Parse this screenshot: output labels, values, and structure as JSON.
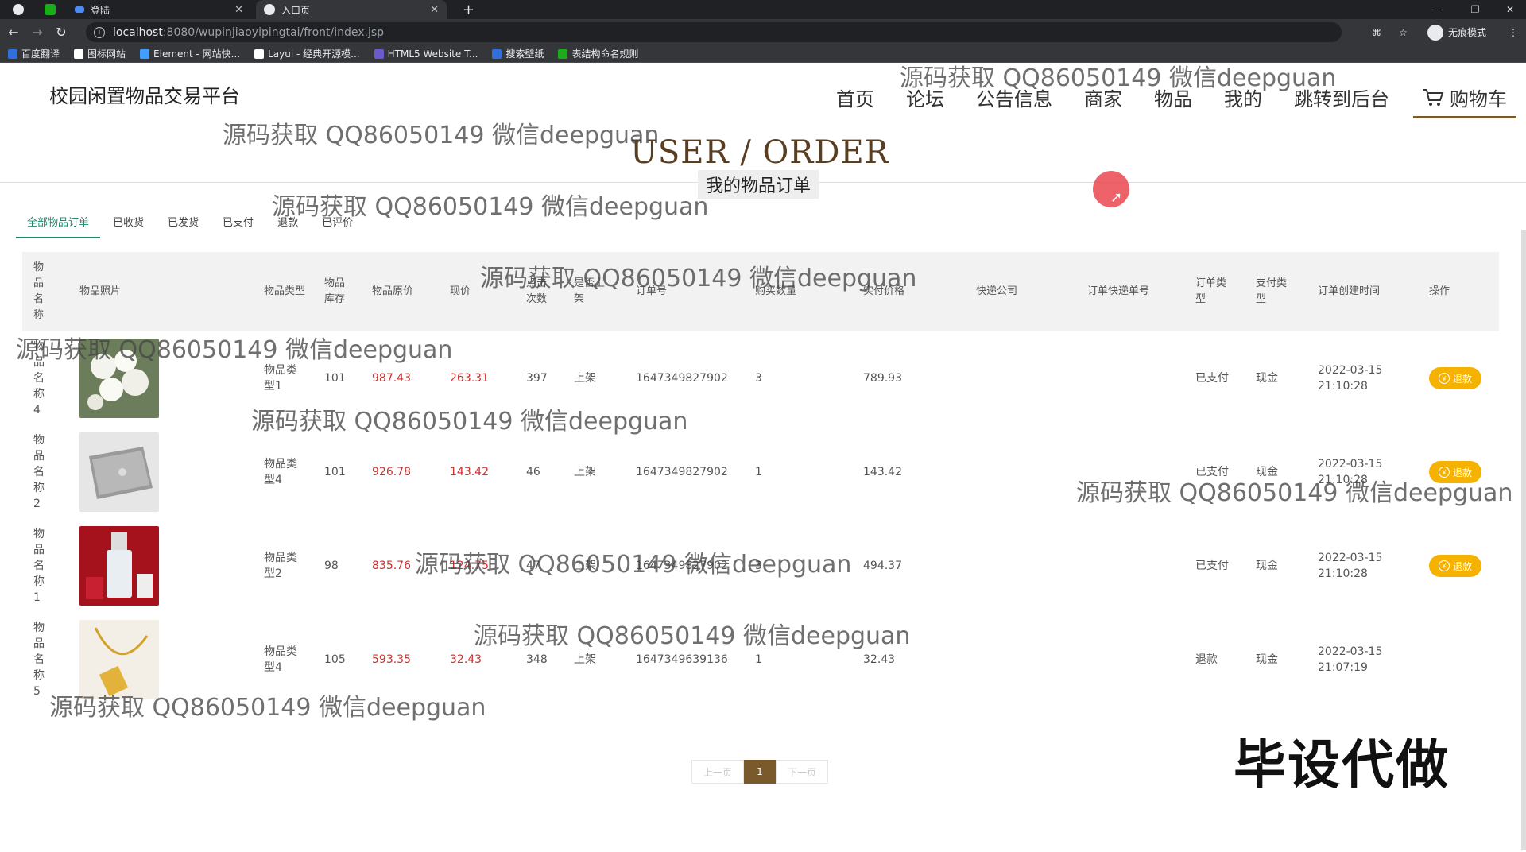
{
  "browser": {
    "tabs": [
      {
        "title": "",
        "favicon_color": "#1aad19"
      },
      {
        "title": "登陆",
        "favicon_color": "#4b8bf5"
      },
      {
        "title": "入口页",
        "favicon_color": "#e8eaed"
      }
    ],
    "new_tab": "+",
    "window_controls": [
      "—",
      "❐",
      "✕"
    ],
    "url_host": "localhost",
    "url_path": ":8080/wupinjiaoyipingtai/front/index.jsp",
    "incognito_label": "无痕模式",
    "bookmarks": [
      {
        "label": "百度翻译",
        "color": "#2f6fe0"
      },
      {
        "label": "图标网站",
        "color": "#ffffff"
      },
      {
        "label": "Element - 网站快...",
        "color": "#409eff"
      },
      {
        "label": "Layui - 经典开源模...",
        "color": "#ffffff"
      },
      {
        "label": "HTML5 Website T...",
        "color": "#6a5acd"
      },
      {
        "label": "搜索壁纸",
        "color": "#2f6fe0"
      },
      {
        "label": "表结构命名规则",
        "color": "#1aad19"
      }
    ]
  },
  "site": {
    "title": "校园闲置物品交易平台",
    "nav": [
      "首页",
      "论坛",
      "公告信息",
      "商家",
      "物品",
      "我的",
      "跳转到后台"
    ],
    "cart_label": "购物车"
  },
  "hero": {
    "en": "USER / ORDER",
    "zh": "我的物品订单"
  },
  "order_tabs": [
    "全部物品订单",
    "已收货",
    "已发货",
    "已支付",
    "退款",
    "已评价"
  ],
  "table": {
    "headers": [
      "物品名称",
      "物品照片",
      "物品类型",
      "物品库存",
      "物品原价",
      "现价",
      "点击次数",
      "是否上架",
      "订单号",
      "购买数量",
      "实付价格",
      "快递公司",
      "订单快递单号",
      "订单类型",
      "支付类型",
      "订单创建时间",
      "操作"
    ],
    "rows": [
      {
        "name": "物品名称4",
        "photo": "white-flowers",
        "type": "物品类型1",
        "stock": "101",
        "orig": "987.43",
        "price": "263.31",
        "clicks": "397",
        "shelf": "上架",
        "order_no": "1647349827902",
        "qty": "3",
        "paid": "789.93",
        "courier": "",
        "tracking": "",
        "status": "已支付",
        "pay": "现金",
        "date": "2022-03-15",
        "time": "21:10:28",
        "action": "退款"
      },
      {
        "name": "物品名称2",
        "photo": "laptop",
        "type": "物品类型4",
        "stock": "101",
        "orig": "926.78",
        "price": "143.42",
        "clicks": "46",
        "shelf": "上架",
        "order_no": "1647349827902",
        "qty": "1",
        "paid": "143.42",
        "courier": "",
        "tracking": "",
        "status": "已支付",
        "pay": "现金",
        "date": "2022-03-15",
        "time": "21:10:28",
        "action": "退款"
      },
      {
        "name": "物品名称1",
        "photo": "perfume",
        "type": "物品类型2",
        "stock": "98",
        "orig": "835.76",
        "price": "124.75",
        "clicks": "47",
        "shelf": "上架",
        "order_no": "1647349827902",
        "qty": "3",
        "paid": "494.37",
        "courier": "",
        "tracking": "",
        "status": "已支付",
        "pay": "现金",
        "date": "2022-03-15",
        "time": "21:10:28",
        "action": "退款"
      },
      {
        "name": "物品名称5",
        "photo": "gold-pendant",
        "type": "物品类型4",
        "stock": "105",
        "orig": "593.35",
        "price": "32.43",
        "clicks": "348",
        "shelf": "上架",
        "order_no": "1647349639136",
        "qty": "1",
        "paid": "32.43",
        "courier": "",
        "tracking": "",
        "status": "退款",
        "pay": "现金",
        "date": "2022-03-15",
        "time": "21:07:19",
        "action": ""
      }
    ]
  },
  "pager": {
    "prev": "上一页",
    "current": "1",
    "next": "下一页"
  },
  "watermark": "源码获取 QQ86050149 微信deepguan",
  "badge": "毕设代做",
  "colors": {
    "accent_brown": "#7a5a2a",
    "tab_green": "#1b8a6b",
    "refund_yellow": "#f6b200",
    "price_red": "#d03030"
  }
}
